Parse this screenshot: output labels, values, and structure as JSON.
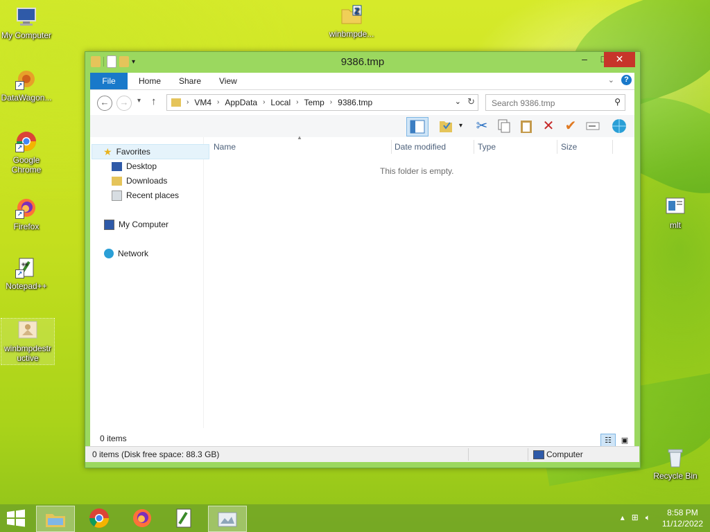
{
  "desktop": {
    "icons": [
      {
        "label": "My Computer"
      },
      {
        "label": "DataWagon..."
      },
      {
        "label": "Google Chrome"
      },
      {
        "label": "Firefox"
      },
      {
        "label": "Notepad++"
      },
      {
        "label": "winbmpdestr uctive"
      },
      {
        "label": "winbmpde..."
      },
      {
        "label": "mlt"
      },
      {
        "label": "Recycle Bin"
      }
    ]
  },
  "window": {
    "title": "9386.tmp",
    "ribbon_tabs": [
      "File",
      "Home",
      "Share",
      "View"
    ],
    "breadcrumb": [
      "VM4",
      "AppData",
      "Local",
      "Temp",
      "9386.tmp"
    ],
    "search_placeholder": "Search 9386.tmp",
    "nav": {
      "favorites": "Favorites",
      "desktop": "Desktop",
      "downloads": "Downloads",
      "recent": "Recent places",
      "computer": "My Computer",
      "network": "Network"
    },
    "columns": [
      "Name",
      "Date modified",
      "Type",
      "Size"
    ],
    "empty_message": "This folder is empty.",
    "item_count": "0 items",
    "status_left": "0 items (Disk free space: 88.3 GB)",
    "status_right": "Computer"
  },
  "taskbar": {
    "time": "8:58 PM",
    "date": "11/12/2022"
  }
}
